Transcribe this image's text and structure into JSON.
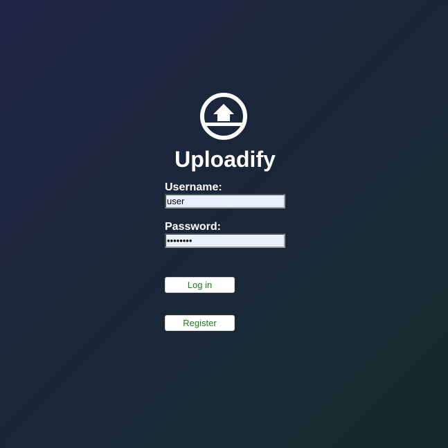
{
  "app": {
    "title": "Uploadify",
    "logo_icon": "upload-arrow-circle-icon"
  },
  "colors": {
    "background_start": "#1d2444",
    "background_end": "#14292a",
    "button_text": "#1f7a1f",
    "input_background": "#e8f0fe"
  },
  "form": {
    "username_label": "Username:",
    "username_value": "user",
    "password_label": "Password:",
    "password_value": "password",
    "login_label": "Log in",
    "register_label": "Register"
  }
}
